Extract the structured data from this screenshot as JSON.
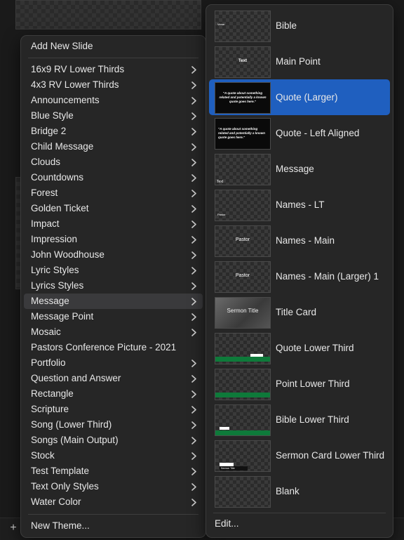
{
  "menu": {
    "add_new_slide": "Add New Slide",
    "themes": [
      {
        "label": "16x9 RV Lower Thirds",
        "submenu": true
      },
      {
        "label": "4x3 RV Lower Thirds",
        "submenu": true
      },
      {
        "label": "Announcements",
        "submenu": true
      },
      {
        "label": "Blue Style",
        "submenu": true
      },
      {
        "label": "Bridge 2",
        "submenu": true
      },
      {
        "label": "Child Message",
        "submenu": true
      },
      {
        "label": "Clouds",
        "submenu": true
      },
      {
        "label": "Countdowns",
        "submenu": true
      },
      {
        "label": "Forest",
        "submenu": true
      },
      {
        "label": "Golden Ticket",
        "submenu": true
      },
      {
        "label": "Impact",
        "submenu": true
      },
      {
        "label": "Impression",
        "submenu": true
      },
      {
        "label": "John Woodhouse",
        "submenu": true
      },
      {
        "label": "Lyric Styles",
        "submenu": true
      },
      {
        "label": "Lyrics Styles",
        "submenu": true
      },
      {
        "label": "Message",
        "submenu": true,
        "highlighted": true
      },
      {
        "label": "Message Point",
        "submenu": true
      },
      {
        "label": "Mosaic",
        "submenu": true
      },
      {
        "label": "Pastors Conference Picture - 2021",
        "submenu": false
      },
      {
        "label": "Portfolio",
        "submenu": true
      },
      {
        "label": "Question and Answer",
        "submenu": true
      },
      {
        "label": "Rectangle",
        "submenu": true
      },
      {
        "label": "Scripture",
        "submenu": true
      },
      {
        "label": "Song (Lower Third)",
        "submenu": true
      },
      {
        "label": "Songs (Main Output)",
        "submenu": true
      },
      {
        "label": "Stock",
        "submenu": true
      },
      {
        "label": "Test Template",
        "submenu": true
      },
      {
        "label": "Text Only Styles",
        "submenu": true
      },
      {
        "label": "Water Color",
        "submenu": true
      }
    ],
    "new_theme": "New Theme..."
  },
  "submenu": {
    "items": [
      {
        "label": "Bible",
        "thumb": "checker",
        "thumb_text": "Verse",
        "selected": false
      },
      {
        "label": "Main Point",
        "thumb": "checker",
        "thumb_text": "Text",
        "selected": false
      },
      {
        "label": "Quote (Larger)",
        "thumb": "black",
        "thumb_text": "\"A quote about something related and potentially a known quote goes here.\"",
        "selected": true
      },
      {
        "label": "Quote - Left Aligned",
        "thumb": "black",
        "thumb_text": "\"A quote about something related and potentially a known quote goes here.\"",
        "selected": false
      },
      {
        "label": "Message",
        "thumb": "checker",
        "thumb_text": "Text",
        "selected": false
      },
      {
        "label": "Names - LT",
        "thumb": "checker",
        "thumb_text": "Pastor",
        "selected": false
      },
      {
        "label": "Names - Main",
        "thumb": "checker",
        "thumb_text": "Pastor",
        "selected": false
      },
      {
        "label": "Names - Main (Larger) 1",
        "thumb": "checker",
        "thumb_text": "Pastor",
        "selected": false
      },
      {
        "label": "Title Card",
        "thumb": "title",
        "thumb_text": "Sermon Title",
        "selected": false
      },
      {
        "label": "Quote Lower Third",
        "thumb": "green",
        "thumb_text": "",
        "selected": false
      },
      {
        "label": "Point Lower Third",
        "thumb": "green",
        "thumb_text": "Point",
        "selected": false
      },
      {
        "label": "Bible Lower Third",
        "thumb": "green",
        "thumb_text": "",
        "selected": false
      },
      {
        "label": "Sermon Card Lower Third",
        "thumb": "checker",
        "thumb_text": "Sermon Title",
        "selected": false
      },
      {
        "label": "Blank",
        "thumb": "checker",
        "thumb_text": "",
        "selected": false
      }
    ],
    "edit": "Edit..."
  },
  "colors": {
    "selection": "#1f5fbf",
    "highlight": "#3a3a3c",
    "menu_bg": "#262626",
    "green_bar": "#0e7a3a"
  },
  "icons": {
    "plus": "plus-icon",
    "chevron": "chevron-right-icon"
  }
}
